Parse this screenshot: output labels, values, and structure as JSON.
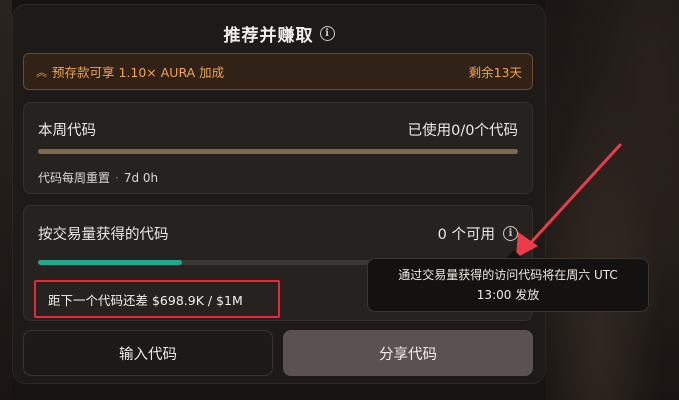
{
  "header": {
    "title": "推荐并赚取",
    "info_icon": "info-circle-icon"
  },
  "promo": {
    "icon": "double-chevron-up-icon",
    "text": "预存款可享 1.10× AURA 加成",
    "remaining": "剩余13天",
    "color": "#f2a450"
  },
  "weekly": {
    "label": "本周代码",
    "usage": "已使用0/0个代码",
    "progress": 1.0,
    "reset_label": "代码每周重置",
    "reset_time": "7d 0h"
  },
  "volume": {
    "label": "按交易量获得的代码",
    "available": "0 个可用",
    "info_icon": "info-circle-icon",
    "progress": 0.3,
    "deficit_text": "距下一个代码还差 $698.9K / $1M",
    "highlight_color": "#e8283a"
  },
  "tooltip": {
    "text": "通过交易量获得的访问代码将在周六 UTC 13:00 发放"
  },
  "buttons": {
    "enter_code": "输入代码",
    "share_code": "分享代码"
  }
}
